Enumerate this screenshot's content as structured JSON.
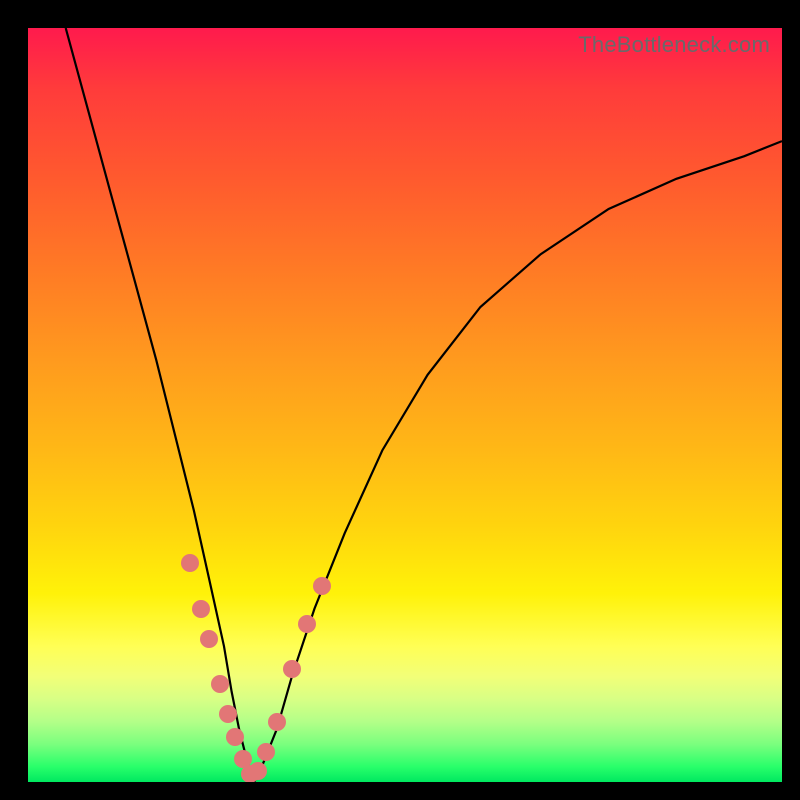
{
  "watermark": "TheBottleneck.com",
  "colors": {
    "frame_bg": "#000000",
    "curve": "#000000",
    "marker": "#e27676",
    "gradient_top": "#ff1a4d",
    "gradient_bottom": "#00e860"
  },
  "chart_data": {
    "type": "line",
    "title": "",
    "xlabel": "",
    "ylabel": "",
    "xlim": [
      0,
      100
    ],
    "ylim": [
      0,
      100
    ],
    "annotations": [
      "TheBottleneck.com"
    ],
    "series": [
      {
        "name": "bottleneck-curve",
        "x": [
          5,
          8,
          11,
          14,
          17,
          20,
          22,
          24,
          26,
          27,
          28,
          29,
          30,
          31,
          33,
          35,
          38,
          42,
          47,
          53,
          60,
          68,
          77,
          86,
          95,
          100
        ],
        "y": [
          100,
          89,
          78,
          67,
          56,
          44,
          36,
          27,
          18,
          12,
          7,
          3,
          0,
          2,
          7,
          14,
          23,
          33,
          44,
          54,
          63,
          70,
          76,
          80,
          83,
          85
        ]
      }
    ],
    "markers": {
      "name": "highlighted-points",
      "x": [
        21.5,
        23.0,
        24.0,
        25.5,
        26.5,
        27.5,
        28.5,
        29.5,
        30.5,
        31.5,
        33.0,
        35.0,
        37.0,
        39.0
      ],
      "y": [
        29.0,
        23.0,
        19.0,
        13.0,
        9.0,
        6.0,
        3.0,
        1.0,
        1.5,
        4.0,
        8.0,
        15.0,
        21.0,
        26.0
      ]
    }
  }
}
